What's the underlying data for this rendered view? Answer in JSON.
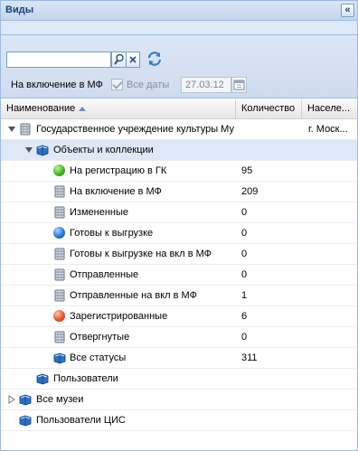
{
  "panel": {
    "title": "Виды",
    "collapse_glyph": "«"
  },
  "toolbar": {
    "search_value": "",
    "inclusion_label": "На включение в МФ",
    "all_dates_label": "Все даты",
    "date_value": "27.03.12"
  },
  "grid": {
    "columns": {
      "name": "Наименование",
      "count": "Количество",
      "city": "Населе..."
    }
  },
  "rows": {
    "r0": {
      "label": "Государственное учреждение культуры Му",
      "city": "г. Моск..."
    },
    "r1": {
      "label": "Объекты и коллекции"
    },
    "r2": {
      "label": "На регистрацию в ГК",
      "count": "95"
    },
    "r3": {
      "label": "На включение в МФ",
      "count": "209"
    },
    "r4": {
      "label": "Измененные",
      "count": "0"
    },
    "r5": {
      "label": "Готовы к выгрузке",
      "count": "0"
    },
    "r6": {
      "label": "Готовы к выгрузке на вкл в МФ",
      "count": "0"
    },
    "r7": {
      "label": "Отправленные",
      "count": "0"
    },
    "r8": {
      "label": "Отправленные на вкл в МФ",
      "count": "1"
    },
    "r9": {
      "label": "Зарегистрированные",
      "count": "6"
    },
    "r10": {
      "label": "Отвергнутые",
      "count": "0"
    },
    "r11": {
      "label": "Все статусы",
      "count": "311"
    },
    "r12": {
      "label": "Пользователи"
    },
    "r13": {
      "label": "Все музеи"
    },
    "r14": {
      "label": "Пользователи ЦИС"
    }
  },
  "icons": {
    "database": "database-icon",
    "book": "book-icon",
    "green": "green-ball-icon",
    "blue": "blue-ball-icon",
    "red": "red-ball-icon"
  },
  "colors": {
    "header_text": "#15428b",
    "border": "#99bbe8",
    "selected_row": "#dfe8f6"
  }
}
